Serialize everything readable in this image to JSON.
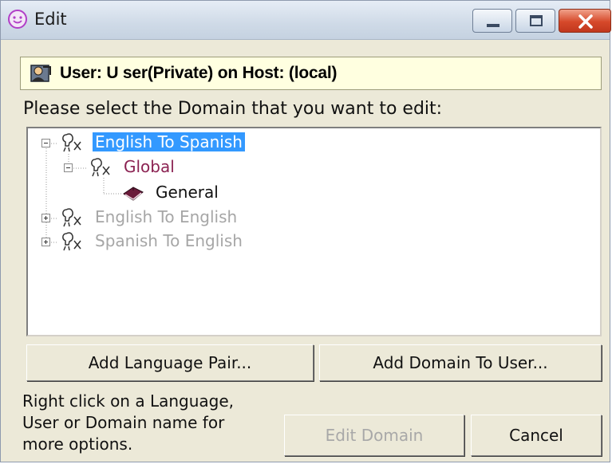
{
  "window": {
    "title": "Edit"
  },
  "user_header": {
    "text": "User: U ser(Private) on Host: (local)"
  },
  "prompt": "Please select the Domain that you want to edit:",
  "tree": {
    "nodes": [
      {
        "label": "English To Spanish",
        "state": "selected",
        "expanded": true
      },
      {
        "label": "Global",
        "state": "normal",
        "expanded": true
      },
      {
        "label": "General",
        "state": "normal",
        "icon": "book-icon"
      },
      {
        "label": "English To English",
        "state": "disabled",
        "expanded": false
      },
      {
        "label": "Spanish To English",
        "state": "disabled",
        "expanded": false
      }
    ]
  },
  "buttons": {
    "add_language_pair": "Add Language Pair...",
    "add_domain_to_user": "Add Domain To User...",
    "edit_domain": "Edit Domain",
    "cancel": "Cancel"
  },
  "hint": {
    "lines": [
      "Right click on a Language,",
      "User or Domain name for",
      "more options."
    ]
  },
  "colors": {
    "selection": "#3399ff",
    "global_label": "#8b2252",
    "user_bar_bg": "#ffffe0",
    "disabled_text": "#a6a6a6"
  }
}
